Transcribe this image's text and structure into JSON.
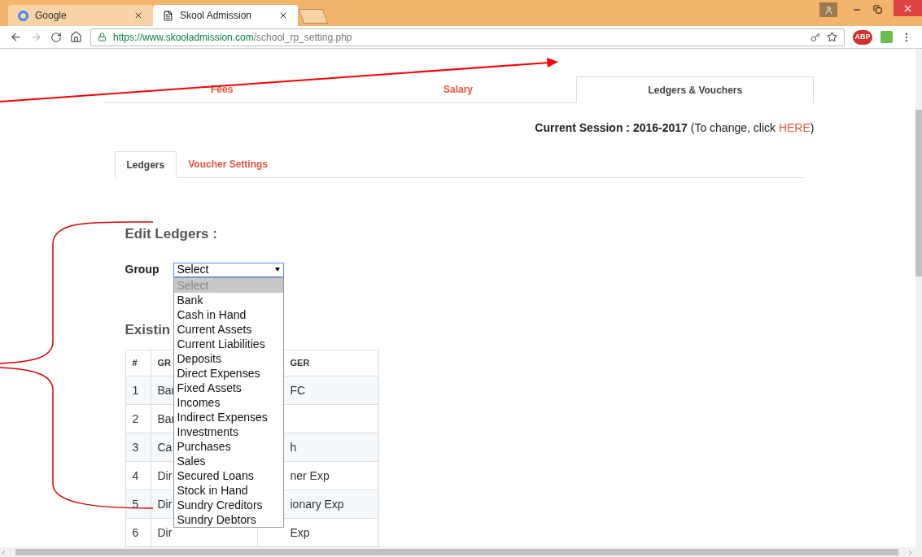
{
  "browser": {
    "tabs": [
      {
        "title": "Google",
        "selected": false,
        "kind": "google"
      },
      {
        "title": "Skool Admission",
        "selected": true,
        "kind": "page"
      }
    ],
    "url": {
      "host": "https://www.skooladmission.com",
      "path": "/school_rp_setting.php"
    },
    "extension_label": "ABP"
  },
  "main_tabs": [
    {
      "label": "Fees",
      "selected": false
    },
    {
      "label": "Salary",
      "selected": false
    },
    {
      "label": "Ledgers & Vouchers",
      "selected": true
    }
  ],
  "session": {
    "label": "Current Session : 2016-2017",
    "note": "(To change, click ",
    "link": "HERE",
    "close": ")"
  },
  "sub_tabs": [
    {
      "label": "Ledgers",
      "selected": true
    },
    {
      "label": "Voucher Settings",
      "selected": false
    }
  ],
  "heading": "Edit Ledgers :",
  "group_label": "Group",
  "select": {
    "value": "Select",
    "expanded": true,
    "options": [
      {
        "label": "Select",
        "selected": true
      },
      {
        "label": "Bank",
        "selected": false
      },
      {
        "label": "Cash in Hand",
        "selected": false
      },
      {
        "label": "Current Assets",
        "selected": false
      },
      {
        "label": "Current Liabilities",
        "selected": false
      },
      {
        "label": "Deposits",
        "selected": false
      },
      {
        "label": "Direct Expenses",
        "selected": false
      },
      {
        "label": "Fixed Assets",
        "selected": false
      },
      {
        "label": "Incomes",
        "selected": false
      },
      {
        "label": "Indirect Expenses",
        "selected": false
      },
      {
        "label": "Investments",
        "selected": false
      },
      {
        "label": "Purchases",
        "selected": false
      },
      {
        "label": "Sales",
        "selected": false
      },
      {
        "label": "Secured Loans",
        "selected": false
      },
      {
        "label": "Stock in Hand",
        "selected": false
      },
      {
        "label": "Sundry Creditors",
        "selected": false
      },
      {
        "label": "Sundry Debtors",
        "selected": false
      }
    ]
  },
  "existing_heading": "Existin",
  "table": {
    "columns": [
      "#",
      "GR",
      "GER"
    ],
    "rows": [
      {
        "num": "1",
        "group": "Bar",
        "ledger": "FC"
      },
      {
        "num": "2",
        "group": "Bar",
        "ledger": ""
      },
      {
        "num": "3",
        "group": "Ca",
        "ledger": "h"
      },
      {
        "num": "4",
        "group": "Dir",
        "ledger": "ner Exp"
      },
      {
        "num": "5",
        "group": "Dir",
        "ledger": "ionary Exp"
      },
      {
        "num": "6",
        "group": "Dir",
        "ledger": "Exp"
      }
    ]
  }
}
